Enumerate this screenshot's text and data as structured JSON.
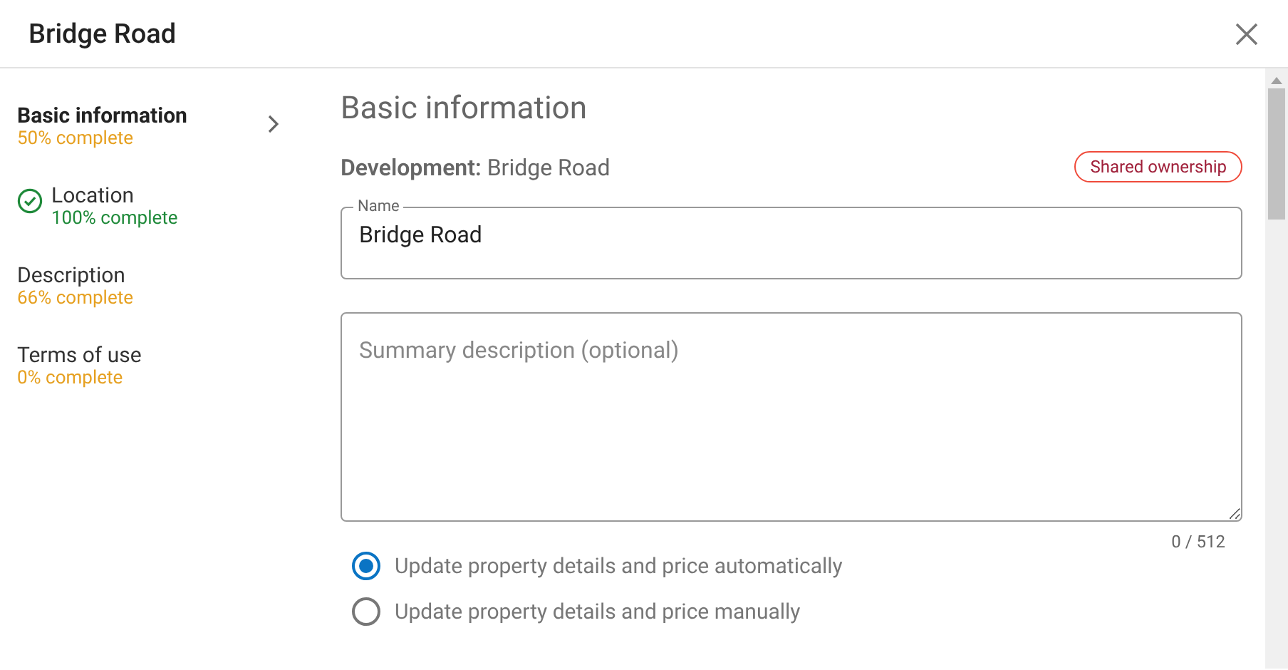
{
  "window": {
    "title": "Bridge Road"
  },
  "sidebar": {
    "items": [
      {
        "label": "Basic information",
        "progress": "50% complete",
        "selected": true,
        "complete": false
      },
      {
        "label": "Location",
        "progress": "100% complete",
        "selected": false,
        "complete": true
      },
      {
        "label": "Description",
        "progress": "66% complete",
        "selected": false,
        "complete": false
      },
      {
        "label": "Terms of use",
        "progress": "0% complete",
        "selected": false,
        "complete": false
      }
    ]
  },
  "content": {
    "heading": "Basic information",
    "development_label": "Development:",
    "development_value": "Bridge Road",
    "badge": "Shared ownership",
    "name_field": {
      "label": "Name",
      "value": "Bridge Road"
    },
    "summary_field": {
      "placeholder": "Summary description (optional)",
      "counter": "0 / 512"
    },
    "options": [
      {
        "label": "Update property details and price automatically",
        "selected": true
      },
      {
        "label": "Update property details and price manually",
        "selected": false
      }
    ]
  }
}
